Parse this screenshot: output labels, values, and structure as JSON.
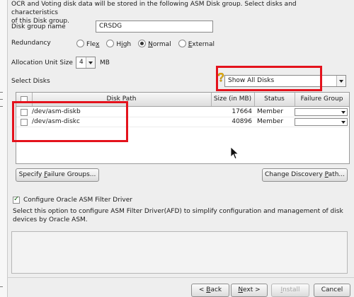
{
  "intro_text_line1": "OCR and Voting disk data will be stored in the following ASM Disk group. Select disks and characteristics",
  "intro_text_line2": "of this Disk group.",
  "disk_group": {
    "label": "Disk group name",
    "value": "CRSDG"
  },
  "redundancy": {
    "label": "Redundancy",
    "options": [
      {
        "pre": "Fle",
        "ul": "x",
        "post": "",
        "selected": false
      },
      {
        "pre": "H",
        "ul": "i",
        "post": "gh",
        "selected": false
      },
      {
        "pre": "",
        "ul": "N",
        "post": "ormal",
        "selected": true
      },
      {
        "pre": "",
        "ul": "E",
        "post": "xternal",
        "selected": false
      }
    ]
  },
  "allocation": {
    "label": "Allocation Unit Size",
    "value": "4",
    "unit": "MB"
  },
  "select_disks": {
    "label": "Select Disks",
    "filter_value": "Show All Disks"
  },
  "table": {
    "headers": {
      "disk_path": "Disk Path",
      "size": "Size (in MB)",
      "status": "Status",
      "failure_group": "Failure Group"
    },
    "rows": [
      {
        "path": "/dev/asm-diskb",
        "size": "17664",
        "status": "Member",
        "checked": false
      },
      {
        "path": "/dev/asm-diskc",
        "size": "40896",
        "status": "Member",
        "checked": false
      }
    ]
  },
  "buttons": {
    "specify_failure_groups": {
      "pre": "Specify ",
      "ul": "F",
      "post": "ailure Groups..."
    },
    "change_discovery_path": {
      "pre": "Change Discovery ",
      "ul": "P",
      "post": "ath..."
    },
    "back": {
      "pre": "< ",
      "ul": "B",
      "post": "ack"
    },
    "next": {
      "pre": "",
      "ul": "N",
      "post": "ext >"
    },
    "install": {
      "pre": "",
      "ul": "I",
      "post": "nstall"
    },
    "cancel": {
      "pre": "Cancel",
      "ul": "",
      "post": ""
    }
  },
  "afd": {
    "checkbox_label": "Configure Oracle ASM Filter Driver",
    "checked": true,
    "desc_line1": "Select this option to configure ASM Filter Driver(AFD) to simplify configuration and management of disk",
    "desc_line2": "devices by Oracle ASM."
  },
  "colors": {
    "highlight": "#e4121c",
    "background": "#eeeeee"
  },
  "icons": {
    "warning": "warning-icon",
    "cursor": "mouse-cursor-icon"
  }
}
